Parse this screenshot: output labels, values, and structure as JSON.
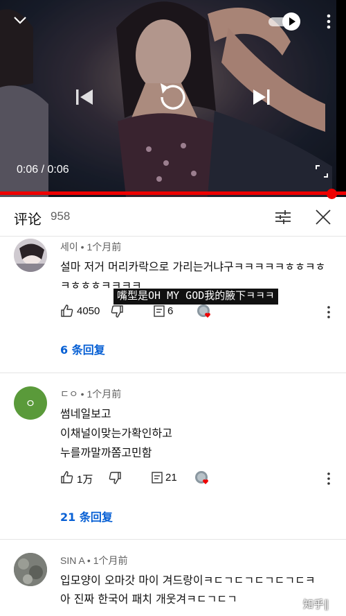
{
  "player": {
    "current_time": "0:06",
    "separator": "/",
    "duration": "0:06",
    "progress": 1.0,
    "autoplay_on": true
  },
  "comments_header": {
    "title": "评论",
    "count": "958"
  },
  "comments": [
    {
      "author": "세이",
      "time": "1个月前",
      "lines": [
        "설마 저거 머리카락으로 가리는거냐구ㅋㅋㅋㅋㅋㅎㅎㅋㅎ",
        "ㅋㅎㅎㅎㅋㅋㅋㅋ"
      ],
      "likes": "4050",
      "replies": "6",
      "replies_link": "6 条回复"
    },
    {
      "author": "ㄷㅇ",
      "time": "1个月前",
      "lines": [
        "썸네일보고",
        "이채널이맞는가확인하고",
        "누를까말까쫌고민함"
      ],
      "likes": "1万",
      "replies": "21",
      "replies_link": "21 条回复"
    },
    {
      "author": "SIN A",
      "time": "1个月前",
      "lines": [
        "입모양이 오마갓 마이 겨드랑이ㅋㄷㄱㄷㄱㄷㄱㄷㄱㄷㅋ",
        "아 진짜 한국어 패치 개웃겨ㅋㄷㄱㄷㄱ"
      ]
    }
  ],
  "overlay_caption": "嘴型是OH MY GOD我的腋下ㅋㅋㅋ",
  "watermark": "知乎",
  "meta_separator": "•",
  "colors": {
    "accent_red": "#e00000",
    "link_blue": "#065fd4",
    "avatar_green": "#5a9a3a"
  }
}
